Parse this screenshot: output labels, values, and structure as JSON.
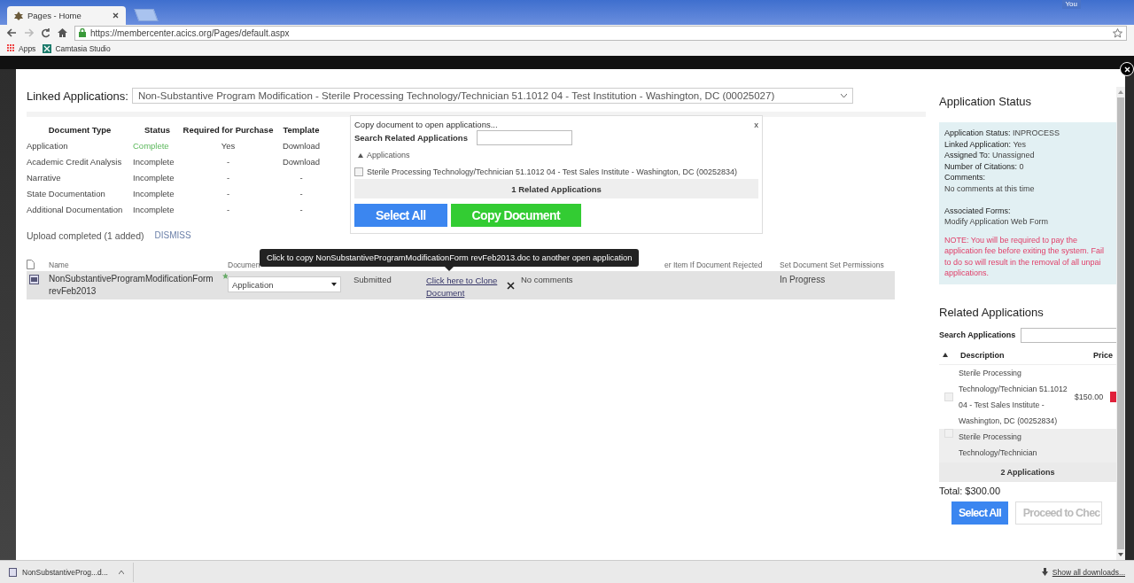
{
  "browser": {
    "tabs": [
      {
        "title": "Pages - Home",
        "selected": true
      }
    ],
    "profile": "You",
    "url": "https://membercenter.acics.org/Pages/default.aspx",
    "bookmarks": [
      "Apps",
      "Camtasia Studio"
    ]
  },
  "linked_applications": {
    "label": "Linked Applications:",
    "value": "Non-Substantive Program Modification - Sterile Processing Technology/Technician 51.1012 04 - Test Institution - Washington, DC (00025027)"
  },
  "documents": {
    "columns": [
      "Document Type",
      "Status",
      "Required for Purchase",
      "Template"
    ],
    "rows": [
      {
        "type": "Application",
        "status": "Complete",
        "complete": true,
        "required": "Yes",
        "template": "Download"
      },
      {
        "type": "Academic Credit Analysis",
        "status": "Incomplete",
        "complete": false,
        "required": "-",
        "template": "Download"
      },
      {
        "type": "Narrative",
        "status": "Incomplete",
        "complete": false,
        "required": "-",
        "template": "-"
      },
      {
        "type": "State Documentation",
        "status": "Incomplete",
        "complete": false,
        "required": "-",
        "template": "-"
      },
      {
        "type": "Additional Documentation",
        "status": "Incomplete",
        "complete": false,
        "required": "-",
        "template": "-"
      }
    ]
  },
  "upload": {
    "message": "Upload completed (1 added)",
    "dismiss": "DISMISS"
  },
  "files": {
    "columns": [
      "Name",
      "Documen",
      "er Item If Document Rejected",
      "Set Document Set Permissions"
    ],
    "rows": [
      {
        "name": "NonSubstantiveProgramModificationForm revFeb2013",
        "document_type": "Application",
        "status": "Submitted",
        "clone_link": "Click here to Clone Document",
        "comments": "No comments",
        "permissions": "In Progress"
      }
    ]
  },
  "tooltip": "Click to copy NonSubstantiveProgramModificationForm revFeb2013.doc to another open application",
  "copy_popup": {
    "title": "Copy document to open applications...",
    "close": "x",
    "search_label": "Search Related Applications",
    "group": "Applications",
    "expanded": true,
    "applications": [
      {
        "label": "Sterile Processing Technology/Technician 51.1012 04 - Test Sales Institute - Washington, DC (00252834)",
        "checked": false
      }
    ],
    "footer": "1 Related Applications",
    "buttons": [
      {
        "label": "Select All",
        "kind": "primary"
      },
      {
        "label": "Copy Document",
        "kind": "success"
      }
    ]
  },
  "application_status": {
    "title": "Application Status",
    "fields": [
      {
        "label": "Application Status:",
        "value": "INPROCESS"
      },
      {
        "label": "Linked Application:",
        "value": "Yes"
      },
      {
        "label": "Assigned To:",
        "value": "Unassigned"
      },
      {
        "label": "Number of Citations:",
        "value": "0"
      }
    ],
    "comments_label": "Comments:",
    "comments": "No comments at this time",
    "forms_label": "Associated Forms:",
    "forms": "Modify Application Web Form",
    "note_lines": [
      "NOTE: You will be required to pay the",
      "application fee before exiting the system. Fail",
      "to do so will result in the removal of all unpai",
      "applications."
    ]
  },
  "related_applications": {
    "title": "Related Applications",
    "search_label": "Search Applications",
    "columns": [
      "Description",
      "Price"
    ],
    "rows": [
      {
        "description": "Sterile Processing Technology/Technician 51.1012 04 - Test Sales Institute - Washington, DC (00252834)",
        "price": "$150.00",
        "checked": false,
        "selected": false
      },
      {
        "description": "Sterile Processing Technology/Technician",
        "checked": false,
        "selected": true
      }
    ],
    "footer": "2 Applications",
    "total": "Total: $300.00",
    "buttons": [
      {
        "label": "Select All",
        "disabled": false
      },
      {
        "label": "Proceed to Chec",
        "disabled": true
      }
    ]
  },
  "downloads": {
    "file": "NonSubstantiveProg...d...",
    "show_all": "Show all downloads..."
  }
}
